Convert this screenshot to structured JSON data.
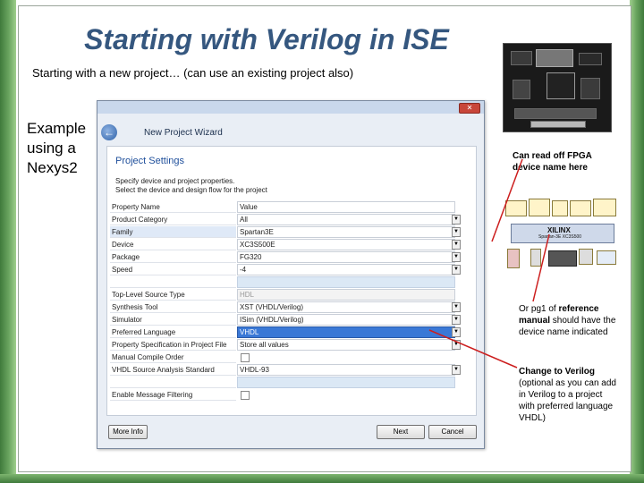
{
  "slide": {
    "title": "Starting with Verilog in ISE",
    "subtitle": "Starting with a new project…  (can use an existing project also)",
    "example_line1": "Example",
    "example_line2": "using a",
    "example_line3": "Nexys2"
  },
  "dialog": {
    "wizard_title": "New Project Wizard",
    "section_title": "Project Settings",
    "section_desc_line1": "Specify device and project properties.",
    "section_desc_line2": "Select the device and design flow for the project",
    "close_glyph": "✕",
    "back_glyph": "←",
    "table_header_name": "Property Name",
    "table_header_value": "Value",
    "rows": [
      {
        "name": "Product Category",
        "value": "All"
      },
      {
        "name": "Family",
        "value": "Spartan3E"
      },
      {
        "name": "Device",
        "value": "XC3S500E"
      },
      {
        "name": "Package",
        "value": "FG320"
      },
      {
        "name": "Speed",
        "value": "-4"
      },
      {
        "name": "Top-Level Source Type",
        "value": "HDL"
      },
      {
        "name": "Synthesis Tool",
        "value": "XST (VHDL/Verilog)"
      },
      {
        "name": "Simulator",
        "value": "ISim (VHDL/Verilog)"
      },
      {
        "name": "Preferred Language",
        "value": "VHDL"
      },
      {
        "name": "Property Specification in Project File",
        "value": "Store all values"
      },
      {
        "name": "Manual Compile Order",
        "value": ""
      },
      {
        "name": "VHDL Source Analysis Standard",
        "value": "VHDL-93"
      },
      {
        "name": "Enable Message Filtering",
        "value": ""
      }
    ],
    "more_info_label": "More Info",
    "next_label": "Next",
    "cancel_label": "Cancel"
  },
  "annotations": {
    "board_note_line1": "Can read off FPGA",
    "board_note_line2": "device name here",
    "ref_note_pre": "Or pg1 of ",
    "ref_note_bold": "reference manual",
    "ref_note_post": " should have the device name indicated",
    "verilog_note_bold": "Change to Verilog",
    "verilog_note_rest": "(optional as you can add in Verilog to a project with preferred language VHDL)"
  },
  "ref_manual": {
    "chip_title": "XILINX",
    "chip_sub": "Spartan-3E XC3S500"
  },
  "colors": {
    "title": "#35577f",
    "accent_green": "#6aa560",
    "highlight_blue": "#3a78d6",
    "arrow_red": "#cc1e1e"
  }
}
